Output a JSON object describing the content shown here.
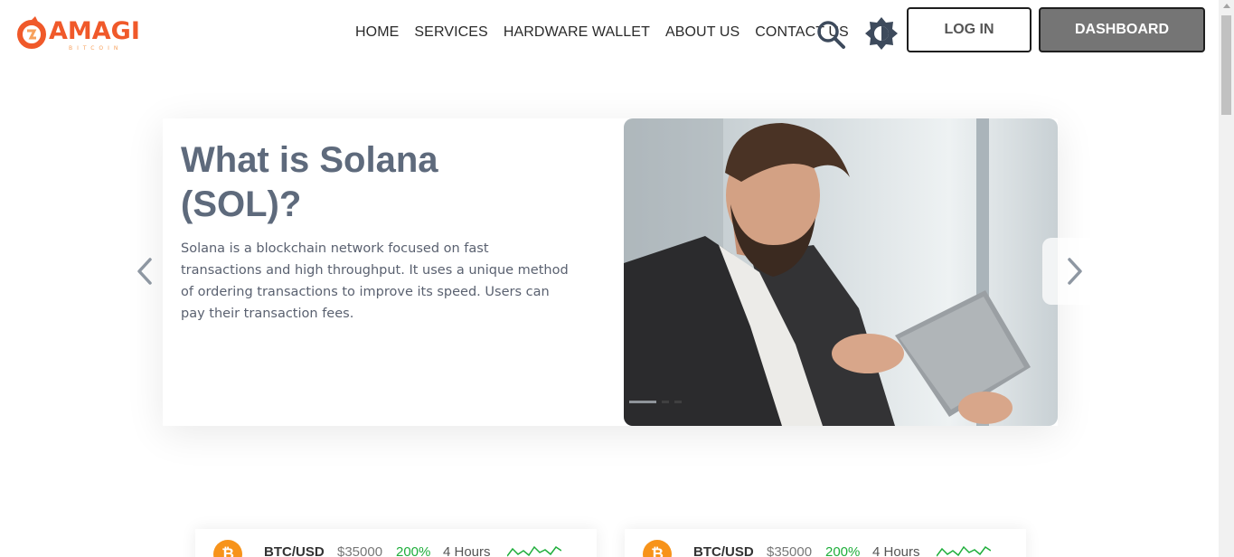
{
  "brand": {
    "name": "AMAGI",
    "tagline": "BITCOIN",
    "accent": "#f0592a"
  },
  "nav": {
    "items": [
      "HOME",
      "SERVICES",
      "HARDWARE WALLET",
      "ABOUT US",
      "CONTACT US"
    ]
  },
  "header": {
    "search_icon": "search-icon",
    "theme_icon": "theme-toggle-icon",
    "login_label": "LOG IN",
    "dashboard_label": "DASHBOARD"
  },
  "carousel": {
    "title": "What is Solana (SOL)?",
    "description": "Solana is a blockchain network focused on fast transactions and high throughput. It uses a unique method of ordering transactions to improve its speed. Users can pay their transaction fees.",
    "image": "man-with-tablet-photo",
    "prev_icon": "chevron-left-icon",
    "next_icon": "chevron-right-icon",
    "active_slide": 1,
    "slide_count": 3
  },
  "tickers": [
    {
      "pair": "BTC/USD",
      "price": "$35000",
      "change": "200%",
      "period": "4 Hours",
      "coin_icon": "bitcoin-icon",
      "change_color": "#1fae3b"
    },
    {
      "pair": "BTC/USD",
      "price": "$35000",
      "change": "200%",
      "period": "4 Hours",
      "coin_icon": "bitcoin-icon",
      "change_color": "#1fae3b"
    }
  ]
}
